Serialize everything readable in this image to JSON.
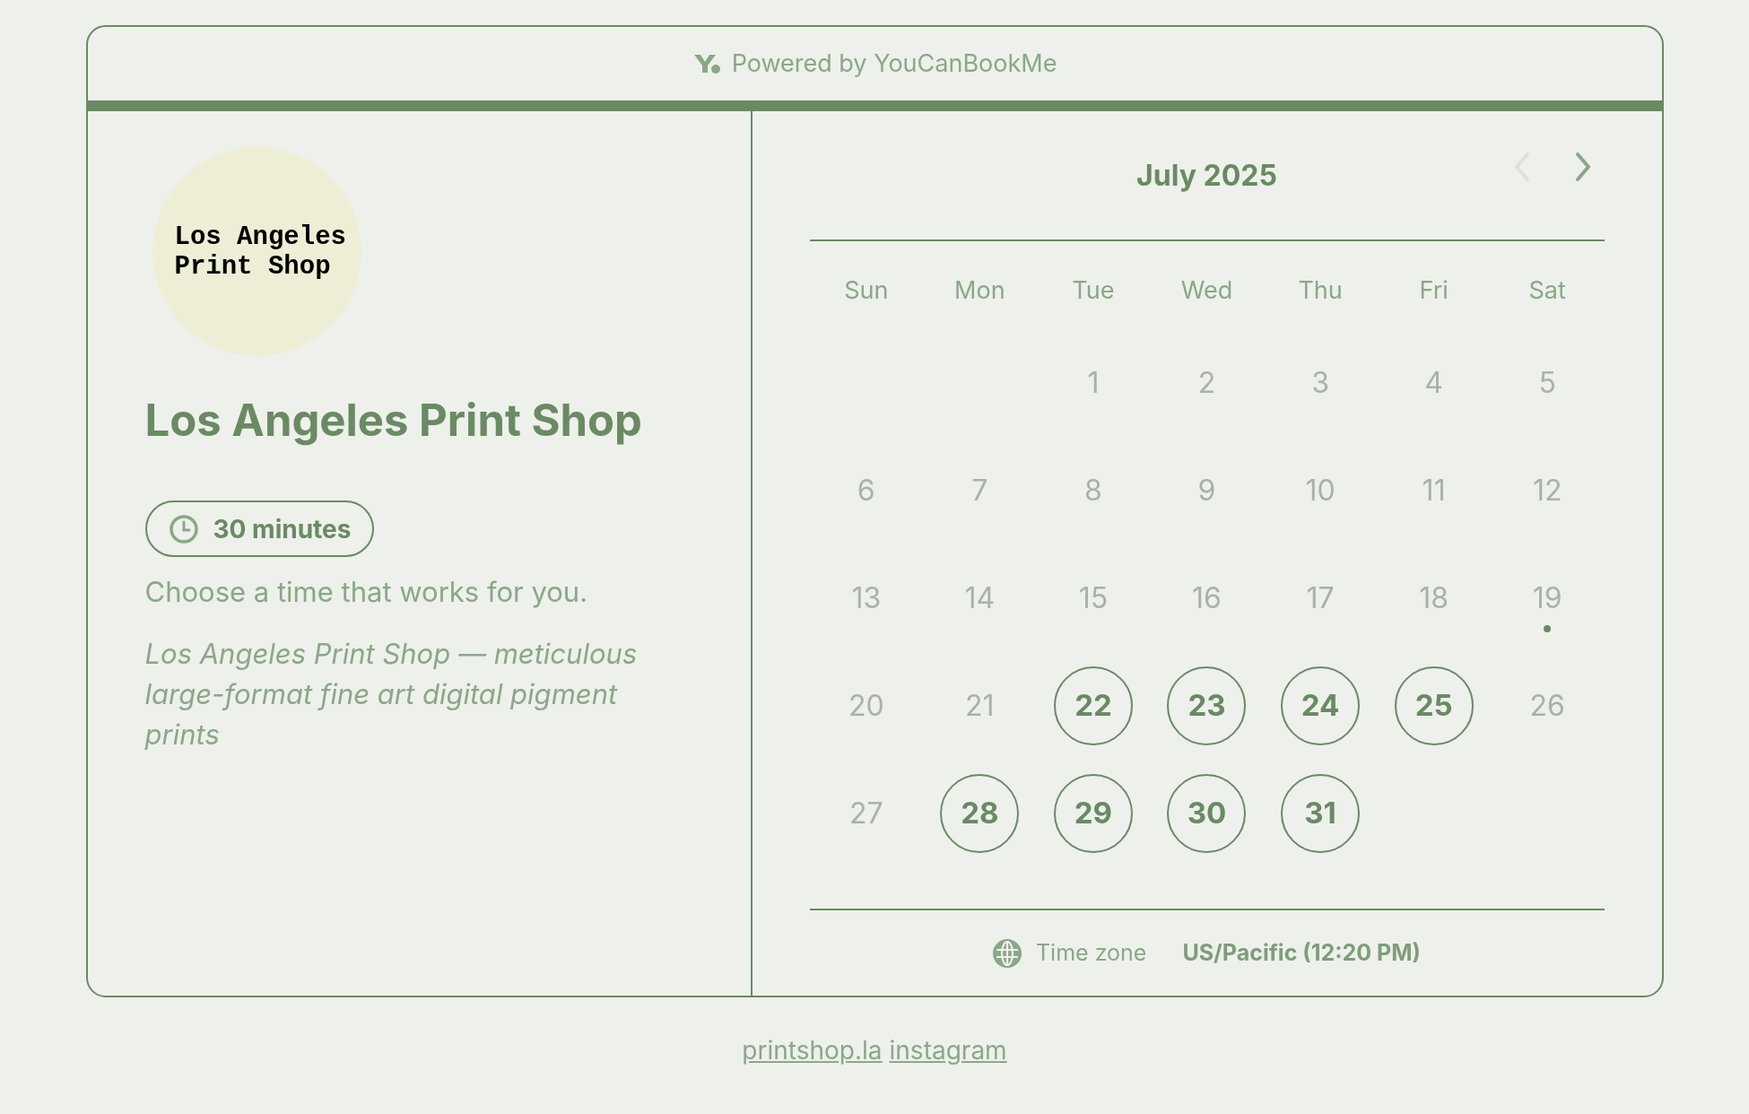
{
  "header": {
    "powered_by": "Powered by YouCanBookMe"
  },
  "profile": {
    "logo_lines": [
      "Los Angeles",
      "Print Shop"
    ],
    "title": "Los Angeles Print Shop",
    "duration": "30 minutes",
    "prompt": "Choose a time that works for you.",
    "description": "Los Angeles Print Shop — meticulous large-format fine art digital pigment prints"
  },
  "calendar": {
    "month": "July 2025",
    "prev": {
      "disabled": true
    },
    "next": {
      "disabled": false
    },
    "weekdays": [
      "Sun",
      "Mon",
      "Tue",
      "Wed",
      "Thu",
      "Fri",
      "Sat"
    ],
    "weeks": [
      [
        {
          "label": "1",
          "available": false,
          "today": false
        },
        {
          "label": "2",
          "available": false,
          "today": false
        },
        {
          "label": "3",
          "available": false,
          "today": false
        },
        {
          "label": "4",
          "available": false,
          "today": false
        },
        {
          "label": "5",
          "available": false,
          "today": false
        }
      ],
      [
        {
          "label": "6",
          "available": false,
          "today": false
        },
        {
          "label": "7",
          "available": false,
          "today": false
        },
        {
          "label": "8",
          "available": false,
          "today": false
        },
        {
          "label": "9",
          "available": false,
          "today": false
        },
        {
          "label": "10",
          "available": false,
          "today": false
        },
        {
          "label": "11",
          "available": false,
          "today": false
        },
        {
          "label": "12",
          "available": false,
          "today": false
        }
      ],
      [
        {
          "label": "13",
          "available": false,
          "today": false
        },
        {
          "label": "14",
          "available": false,
          "today": false
        },
        {
          "label": "15",
          "available": false,
          "today": false
        },
        {
          "label": "16",
          "available": false,
          "today": false
        },
        {
          "label": "17",
          "available": false,
          "today": false
        },
        {
          "label": "18",
          "available": false,
          "today": false
        },
        {
          "label": "19",
          "available": false,
          "today": true
        }
      ],
      [
        {
          "label": "20",
          "available": false,
          "today": false
        },
        {
          "label": "21",
          "available": false,
          "today": false
        },
        {
          "label": "22",
          "available": true,
          "today": false
        },
        {
          "label": "23",
          "available": true,
          "today": false
        },
        {
          "label": "24",
          "available": true,
          "today": false
        },
        {
          "label": "25",
          "available": true,
          "today": false
        },
        {
          "label": "26",
          "available": false,
          "today": false
        }
      ],
      [
        {
          "label": "27",
          "available": false,
          "today": false
        },
        {
          "label": "28",
          "available": true,
          "today": false
        },
        {
          "label": "29",
          "available": true,
          "today": false
        },
        {
          "label": "30",
          "available": true,
          "today": false
        },
        {
          "label": "31",
          "available": true,
          "today": false
        }
      ]
    ],
    "timezone_label": "Time zone",
    "timezone_value": "US/Pacific (12:20 PM)"
  },
  "footer_links": [
    "printshop.la",
    "instagram"
  ]
}
